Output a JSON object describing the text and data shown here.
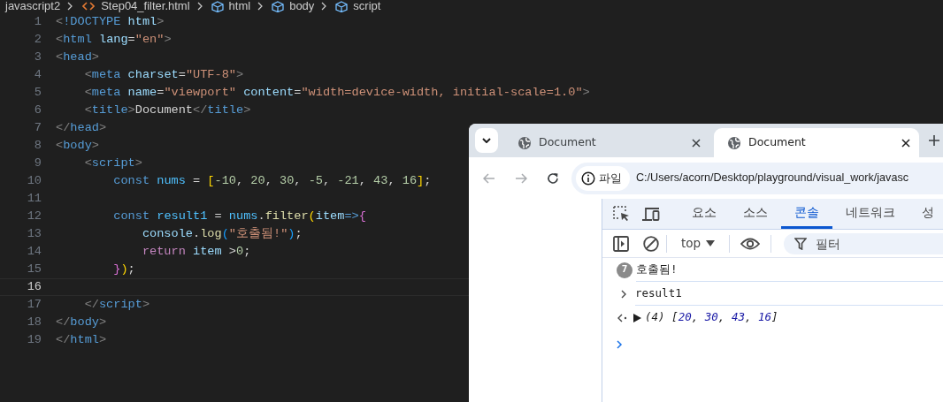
{
  "editor": {
    "breadcrumb": [
      {
        "kind": "folder",
        "label": "javascript2"
      },
      {
        "kind": "file",
        "label": "Step04_filter.html"
      },
      {
        "kind": "element",
        "label": "html"
      },
      {
        "kind": "element",
        "label": "body"
      },
      {
        "kind": "element",
        "label": "script"
      }
    ],
    "lines": [
      {
        "number": "1",
        "selected": false,
        "tokens": [
          {
            "kind": "punct",
            "text": "<"
          },
          {
            "kind": "tag",
            "text": "!DOCTYPE"
          },
          {
            "kind": "attr",
            "text": " html"
          },
          {
            "kind": "punct",
            "text": ">"
          }
        ]
      },
      {
        "number": "2",
        "selected": false,
        "tokens": [
          {
            "kind": "punct",
            "text": "<"
          },
          {
            "kind": "tag",
            "text": "html"
          },
          {
            "kind": "attr",
            "text": " lang"
          },
          {
            "kind": "plain",
            "text": "="
          },
          {
            "kind": "string",
            "text": "\"en\""
          },
          {
            "kind": "punct",
            "text": ">"
          }
        ]
      },
      {
        "number": "3",
        "selected": false,
        "tokens": [
          {
            "kind": "punct",
            "text": "<"
          },
          {
            "kind": "tag",
            "text": "head"
          },
          {
            "kind": "punct",
            "text": ">"
          }
        ]
      },
      {
        "number": "4",
        "selected": false,
        "tokens": [
          {
            "kind": "punct",
            "text": "    <"
          },
          {
            "kind": "tag",
            "text": "meta"
          },
          {
            "kind": "attr",
            "text": " charset"
          },
          {
            "kind": "plain",
            "text": "="
          },
          {
            "kind": "string",
            "text": "\"UTF-8\""
          },
          {
            "kind": "punct",
            "text": ">"
          }
        ]
      },
      {
        "number": "5",
        "selected": false,
        "tokens": [
          {
            "kind": "punct",
            "text": "    <"
          },
          {
            "kind": "tag",
            "text": "meta"
          },
          {
            "kind": "attr",
            "text": " name"
          },
          {
            "kind": "plain",
            "text": "="
          },
          {
            "kind": "string",
            "text": "\"viewport\""
          },
          {
            "kind": "attr",
            "text": " content"
          },
          {
            "kind": "plain",
            "text": "="
          },
          {
            "kind": "string",
            "text": "\"width=device-width, initial-scale=1.0\""
          },
          {
            "kind": "punct",
            "text": ">"
          }
        ]
      },
      {
        "number": "6",
        "selected": false,
        "tokens": [
          {
            "kind": "punct",
            "text": "    <"
          },
          {
            "kind": "tag",
            "text": "title"
          },
          {
            "kind": "punct",
            "text": ">"
          },
          {
            "kind": "plain",
            "text": "Document"
          },
          {
            "kind": "punct",
            "text": "</"
          },
          {
            "kind": "tag",
            "text": "title"
          },
          {
            "kind": "punct",
            "text": ">"
          }
        ]
      },
      {
        "number": "7",
        "selected": false,
        "tokens": [
          {
            "kind": "punct",
            "text": "</"
          },
          {
            "kind": "tag",
            "text": "head"
          },
          {
            "kind": "punct",
            "text": ">"
          }
        ]
      },
      {
        "number": "8",
        "selected": false,
        "tokens": [
          {
            "kind": "punct",
            "text": "<"
          },
          {
            "kind": "tag",
            "text": "body"
          },
          {
            "kind": "punct",
            "text": ">"
          }
        ]
      },
      {
        "number": "9",
        "selected": false,
        "tokens": [
          {
            "kind": "punct",
            "text": "    <"
          },
          {
            "kind": "tag",
            "text": "script"
          },
          {
            "kind": "punct",
            "text": ">"
          }
        ]
      },
      {
        "number": "10",
        "selected": false,
        "tokens": [
          {
            "kind": "keyword",
            "text": "        const "
          },
          {
            "kind": "variable",
            "text": "nums"
          },
          {
            "kind": "plain",
            "text": " = "
          },
          {
            "kind": "bracket1",
            "text": "["
          },
          {
            "kind": "number",
            "text": "-10"
          },
          {
            "kind": "plain",
            "text": ", "
          },
          {
            "kind": "number",
            "text": "20"
          },
          {
            "kind": "plain",
            "text": ", "
          },
          {
            "kind": "number",
            "text": "30"
          },
          {
            "kind": "plain",
            "text": ", "
          },
          {
            "kind": "number",
            "text": "-5"
          },
          {
            "kind": "plain",
            "text": ", "
          },
          {
            "kind": "number",
            "text": "-21"
          },
          {
            "kind": "plain",
            "text": ", "
          },
          {
            "kind": "number",
            "text": "43"
          },
          {
            "kind": "plain",
            "text": ", "
          },
          {
            "kind": "number",
            "text": "16"
          },
          {
            "kind": "bracket1",
            "text": "]"
          },
          {
            "kind": "plain",
            "text": ";"
          }
        ]
      },
      {
        "number": "11",
        "selected": false
      },
      {
        "number": "12",
        "selected": false,
        "tokens": [
          {
            "kind": "keyword",
            "text": "        const "
          },
          {
            "kind": "variable",
            "text": "result1"
          },
          {
            "kind": "plain",
            "text": " = "
          },
          {
            "kind": "variable",
            "text": "nums"
          },
          {
            "kind": "plain",
            "text": "."
          },
          {
            "kind": "function",
            "text": "filter"
          },
          {
            "kind": "bracket1",
            "text": "("
          },
          {
            "kind": "param",
            "text": "item"
          },
          {
            "kind": "keyword",
            "text": "=>"
          },
          {
            "kind": "bracket2",
            "text": "{"
          }
        ]
      },
      {
        "number": "13",
        "selected": false,
        "tokens": [
          {
            "kind": "param",
            "text": "            console"
          },
          {
            "kind": "plain",
            "text": "."
          },
          {
            "kind": "function",
            "text": "log"
          },
          {
            "kind": "bracket3",
            "text": "("
          },
          {
            "kind": "string",
            "text": "\"호출됨!\""
          },
          {
            "kind": "bracket3",
            "text": ")"
          },
          {
            "kind": "plain",
            "text": ";"
          }
        ]
      },
      {
        "number": "14",
        "selected": false,
        "tokens": [
          {
            "kind": "control",
            "text": "            return "
          },
          {
            "kind": "param",
            "text": "item"
          },
          {
            "kind": "plain",
            "text": " >"
          },
          {
            "kind": "number",
            "text": "0"
          },
          {
            "kind": "plain",
            "text": ";"
          }
        ]
      },
      {
        "number": "15",
        "selected": false,
        "tokens": [
          {
            "kind": "bracket2",
            "text": "        }"
          },
          {
            "kind": "bracket1",
            "text": ")"
          },
          {
            "kind": "plain",
            "text": ";"
          }
        ]
      },
      {
        "number": "16",
        "selected": true
      },
      {
        "number": "17",
        "selected": false,
        "tokens": [
          {
            "kind": "punct",
            "text": "    </"
          },
          {
            "kind": "tag",
            "text": "script"
          },
          {
            "kind": "punct",
            "text": ">"
          }
        ]
      },
      {
        "number": "18",
        "selected": false,
        "tokens": [
          {
            "kind": "punct",
            "text": "</"
          },
          {
            "kind": "tag",
            "text": "body"
          },
          {
            "kind": "punct",
            "text": ">"
          }
        ]
      },
      {
        "number": "19",
        "selected": false,
        "tokens": [
          {
            "kind": "punct",
            "text": "</"
          },
          {
            "kind": "tag",
            "text": "html"
          },
          {
            "kind": "punct",
            "text": ">"
          }
        ]
      }
    ]
  },
  "browser": {
    "tabs": [
      {
        "title": "Document",
        "selected": false
      },
      {
        "title": "Document",
        "selected": true
      }
    ],
    "address": {
      "badge": "파일",
      "url": "C:/Users/acorn/Desktop/playground/visual_work/javasc"
    },
    "devtools": {
      "tabs": [
        {
          "label": "요소",
          "selected": false
        },
        {
          "label": "소스",
          "selected": false
        },
        {
          "label": "콘솔",
          "selected": true
        },
        {
          "label": "네트워크",
          "selected": false
        },
        {
          "label": "성",
          "selected": false
        }
      ],
      "context": "top",
      "filter": {
        "placeholder": "필터"
      },
      "messages": [
        {
          "kind": "log",
          "count": "7",
          "text": "호출됨!"
        },
        {
          "kind": "input",
          "text": "result1"
        },
        {
          "kind": "output",
          "tokens": [
            {
              "kind": "plain",
              "text": "(4) ["
            },
            {
              "kind": "number",
              "text": "20"
            },
            {
              "kind": "plain",
              "text": ", "
            },
            {
              "kind": "number",
              "text": "30"
            },
            {
              "kind": "plain",
              "text": ", "
            },
            {
              "kind": "number",
              "text": "43"
            },
            {
              "kind": "plain",
              "text": ", "
            },
            {
              "kind": "number",
              "text": "16"
            },
            {
              "kind": "plain",
              "text": "]"
            }
          ]
        }
      ]
    }
  }
}
